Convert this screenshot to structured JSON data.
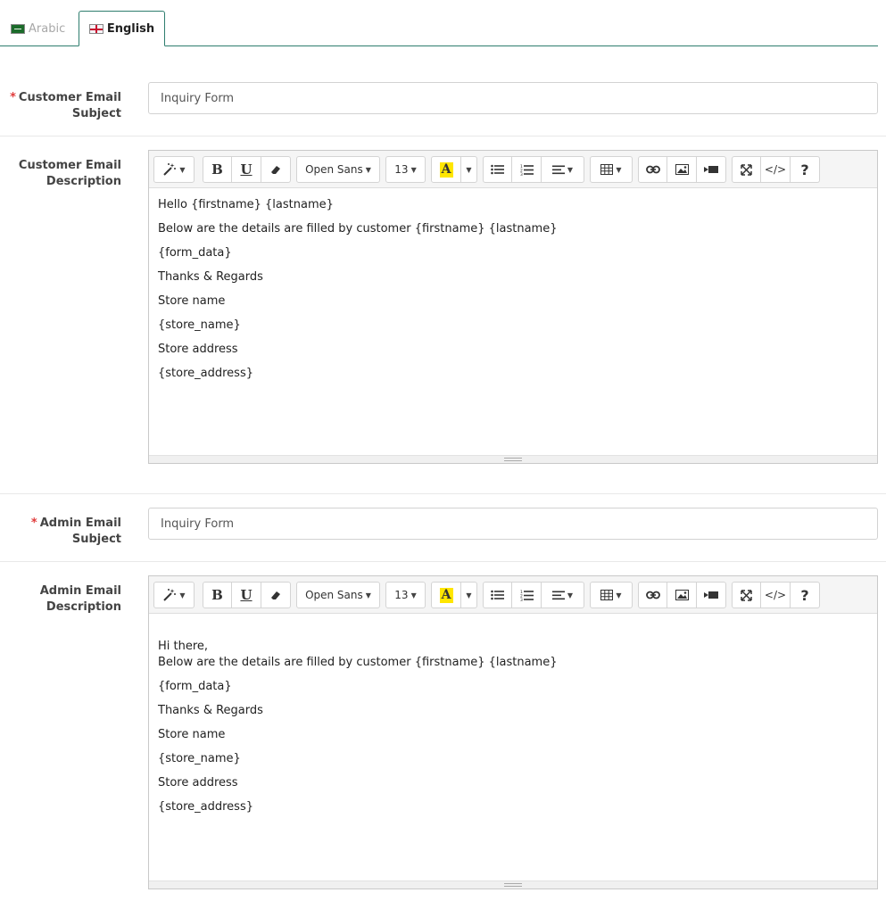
{
  "tabs": [
    {
      "label": "Arabic",
      "active": false
    },
    {
      "label": "English",
      "active": true
    }
  ],
  "customer_subject": {
    "label": "Customer Email Subject",
    "required": true,
    "value": "Inquiry Form"
  },
  "customer_description": {
    "label": "Customer Email Description",
    "toolbar": {
      "font": "Open Sans",
      "size": "13",
      "highlight": "A"
    },
    "lines": [
      "Hello {firstname} {lastname}",
      "Below are the details are filled by customer {firstname} {lastname}",
      "{form_data}",
      "Thanks & Regards",
      "Store name",
      "{store_name}",
      "Store address",
      "{store_address}"
    ]
  },
  "admin_subject": {
    "label": "Admin Email Subject",
    "required": true,
    "value": "Inquiry Form"
  },
  "admin_description": {
    "label": "Admin Email Description",
    "toolbar": {
      "font": "Open Sans",
      "size": "13",
      "highlight": "A"
    },
    "lines": [
      "Hi there,",
      "Below are the details are filled by customer {firstname} {lastname}",
      "{form_data}",
      "Thanks & Regards",
      "Store name",
      "{store_name}",
      "Store address",
      "{store_address}"
    ]
  },
  "icons": [
    "magic-wand-icon",
    "bold-icon",
    "underline-icon",
    "eraser-icon",
    "highlight-color-icon",
    "bullet-list-icon",
    "numbered-list-icon",
    "align-icon",
    "table-icon",
    "link-icon",
    "image-icon",
    "video-icon",
    "fullscreen-icon",
    "code-view-icon",
    "help-icon"
  ],
  "colors": {
    "accent": "#2e7d6e",
    "required": "#e03b3b",
    "highlight": "#ffe600"
  }
}
